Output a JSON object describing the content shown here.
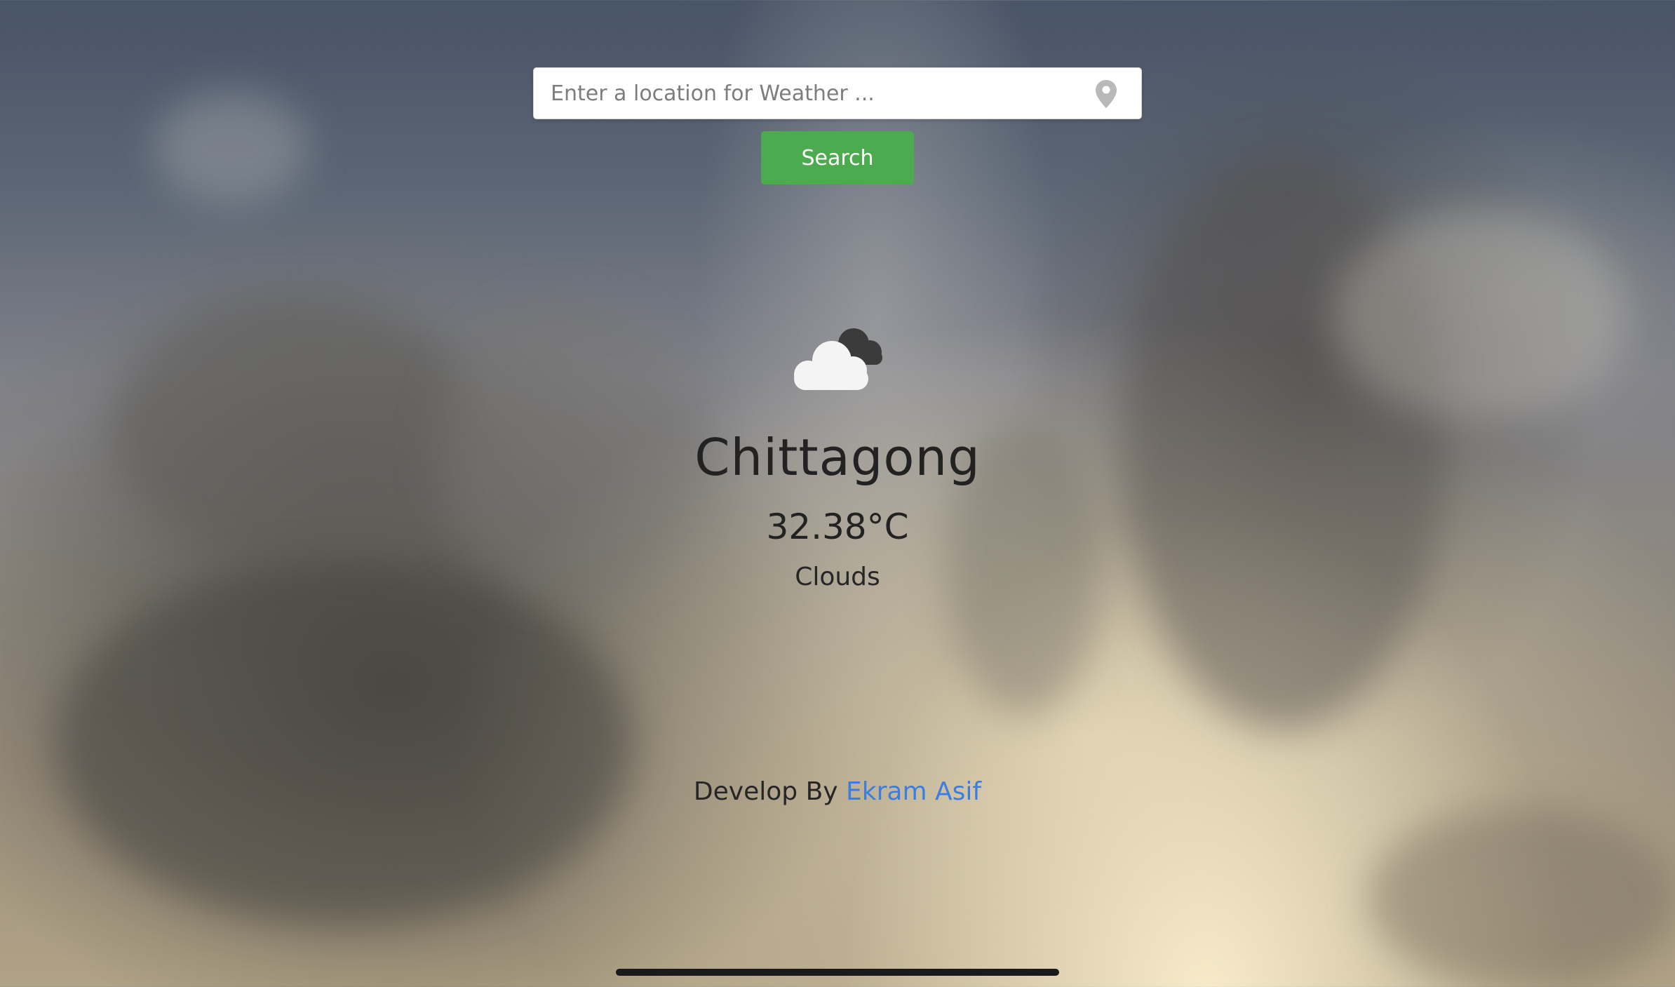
{
  "search": {
    "placeholder": "Enter a location for Weather ...",
    "value": "",
    "location_icon": "map-pin-icon",
    "button_label": "Search",
    "button_color": "#4caa4f"
  },
  "weather": {
    "icon": "clouds-icon",
    "city": "Chittagong",
    "temperature": "32.38°C",
    "condition": "Clouds"
  },
  "footer": {
    "prefix": "Develop By",
    "author": "Ekram Asif",
    "author_color": "#3b7de0"
  }
}
